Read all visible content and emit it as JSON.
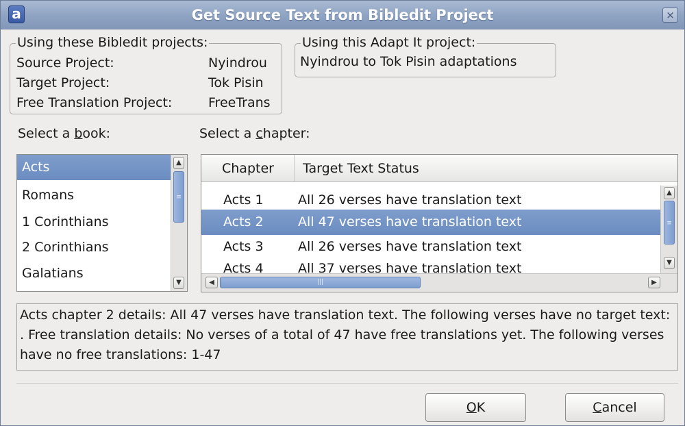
{
  "window": {
    "title": "Get Source Text from Bibledit Project",
    "close_glyph": "×",
    "app_icon_glyph": "a"
  },
  "bibledit_group": {
    "title": "Using these Bibledit projects:",
    "rows": [
      {
        "label": "Source Project:",
        "value": "Nyindrou"
      },
      {
        "label": "Target Project:",
        "value": "Tok Pisin"
      },
      {
        "label": "Free Translation Project:",
        "value": "FreeTrans"
      }
    ]
  },
  "adaptit_group": {
    "title": "Using this Adapt It project:",
    "value": "Nyindrou to Tok Pisin adaptations"
  },
  "book_label": {
    "before": "Select a ",
    "mnemonic": "b",
    "after": "ook:"
  },
  "chapter_label": {
    "before": "Select a ",
    "mnemonic": "c",
    "after": "hapter:"
  },
  "books": {
    "items": [
      "Acts",
      "Romans",
      "1 Corinthians",
      "2 Corinthians",
      "Galatians"
    ],
    "selected": 0
  },
  "chapters": {
    "headers": [
      "Chapter",
      "Target Text Status"
    ],
    "rows": [
      {
        "chapter": "Acts 1",
        "status": "All 26 verses have translation text"
      },
      {
        "chapter": "Acts 2",
        "status": "All 47 verses have translation text"
      },
      {
        "chapter": "Acts 3",
        "status": "All 26 verses have translation text"
      },
      {
        "chapter": "Acts 4",
        "status": "All 37 verses have translation text"
      }
    ],
    "selected": 1
  },
  "details": "Acts chapter 2 details: All 47 verses have translation text. The following verses have no target text:  . Free translation details: No verses of a total of 47 have free translations yet. The following verses have no free translations: 1-47",
  "buttons": {
    "ok": {
      "mnemonic": "O",
      "rest": "K"
    },
    "cancel": {
      "mnemonic": "C",
      "rest": "ancel"
    }
  },
  "icons": {
    "scroll_up": "up-arrow-icon",
    "scroll_down": "down-arrow-icon",
    "scroll_left": "left-arrow-icon",
    "scroll_right": "right-arrow-icon",
    "grip": "grip-icon"
  },
  "colors": {
    "selection": "#6b8cc0",
    "titlebar": "#8ea3c2"
  }
}
